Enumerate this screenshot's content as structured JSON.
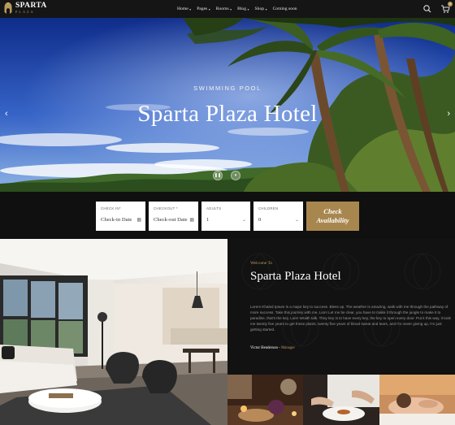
{
  "header": {
    "logo_name": "SPARTA",
    "logo_sub": "PLAZA",
    "nav": [
      {
        "label": "Home",
        "has_caret": true
      },
      {
        "label": "Pages",
        "has_caret": true
      },
      {
        "label": "Rooms",
        "has_caret": true
      },
      {
        "label": "Blog",
        "has_caret": true
      },
      {
        "label": "Shop",
        "has_caret": true
      },
      {
        "label": "Coming soon",
        "has_caret": false
      }
    ],
    "icons": [
      "search-icon",
      "cart-icon"
    ],
    "cart_count": "0"
  },
  "hero": {
    "subtitle": "SWIMMING POOL",
    "title": "Sparta Plaza Hotel",
    "prev_arrow": "‹",
    "next_arrow": "›",
    "pause_glyph": "❚❚",
    "next_glyph": "▾"
  },
  "booking": {
    "checkin": {
      "label": "CHECK IN*",
      "value": "Check-in Date",
      "icon": "calendar-icon"
    },
    "checkout": {
      "label": "CHECKOUT *",
      "value": "Check-out Date",
      "icon": "calendar-icon"
    },
    "adults": {
      "label": "ADULTS",
      "value": "1"
    },
    "children": {
      "label": "CHILDREN",
      "value": "0"
    },
    "button_line1": "Check",
    "button_line2": "Availability"
  },
  "welcome": {
    "label": "Welcome To",
    "title": "Sparta Plaza Hotel",
    "body": "Lorem Khaled Ipsum is a major key to success. Bless up. The weather is amazing, walk with me through the pathway of more success. Take this journey with me, Lion! Let me be clear, you have to make it through the jungle to make it to paradise, that's the key, Lion! Wraith talk. They key is to have every key, the key to open every door. Put it this way, it took me twenty five years to get these plants, twenty five years of blood sweat and tears, and I'm never giving up, I'm just getting started.",
    "author": "Victor Henderson",
    "role": "Manager"
  },
  "colors": {
    "accent": "#a8874f",
    "header_bg": "#151515",
    "welcome_bg": "#121212"
  }
}
